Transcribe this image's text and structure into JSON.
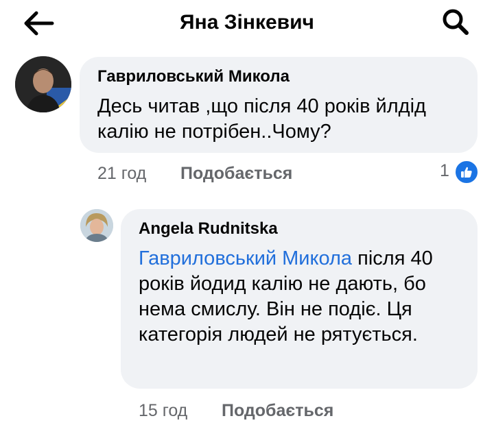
{
  "header": {
    "title": "Яна Зінкевич",
    "back_icon": "arrow-left-icon",
    "search_icon": "search-icon"
  },
  "comments": [
    {
      "author": "Гавриловський Микола",
      "text": "Десь читав ,що після 40 років йлдід калію не потрібен..Чому?",
      "time": "21 год",
      "like_label": "Подобається",
      "reaction_count": "1"
    },
    {
      "author": "Angela Rudnitska",
      "mention": "Гавриловський Микола",
      "text": " після 40 років йодид калію не дають, бо нема смислу. Він не подіє. Ця категорія людей не рятується.",
      "time": "15 год",
      "like_label": "Подобається"
    }
  ],
  "colors": {
    "mention": "#216fdb",
    "meta": "#65676b",
    "bubble": "#f0f2f5",
    "like_badge": "#1b74e4"
  }
}
